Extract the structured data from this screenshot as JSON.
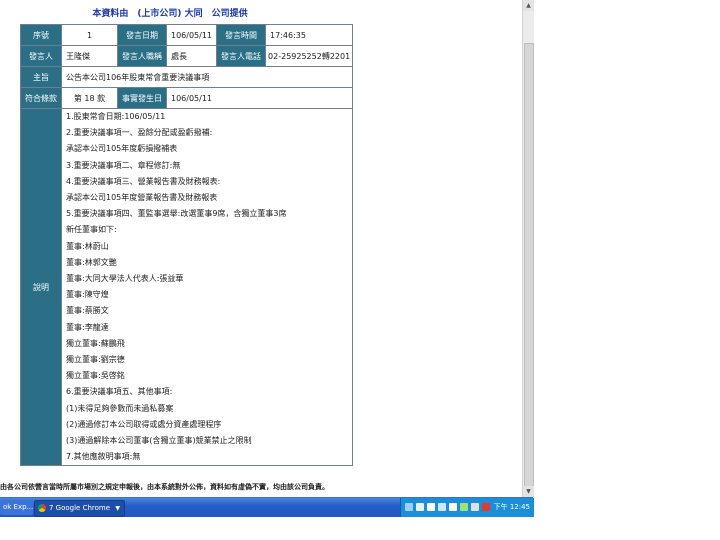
{
  "header": {
    "title": "本資料由　(上市公司) 大同　公司提供"
  },
  "row1": {
    "seq_label": "序號",
    "seq_value": "1",
    "date_label": "發言日期",
    "date_value": "106/05/11",
    "time_label": "發言時間",
    "time_value": "17:46:35"
  },
  "row2": {
    "speaker_label": "發言人",
    "speaker_value": "王隆傑",
    "title_label": "發言人職稱",
    "title_value": "處長",
    "phone_label": "發言人電話",
    "phone_value": "02-25925252轉2201"
  },
  "row3": {
    "subject_label": "主旨",
    "subject_value": "公告本公司106年股東常會重要決議事項"
  },
  "row4": {
    "clause_label": "符合條款",
    "clause_value": "第 18 款",
    "event_date_label": "事實發生日",
    "event_date_value": "106/05/11"
  },
  "description": {
    "label": "說明",
    "lines": [
      "1.股東常會日期:106/05/11",
      "2.重要決議事項一、盈餘分配或盈虧撥補:",
      "承認本公司105年度虧損撥補表",
      "3.重要決議事項二、章程修訂:無",
      "4.重要決議事項三、營業報告書及財務報表:",
      "承認本公司105年度營業報告書及財務報表",
      "5.重要決議事項四、董監事選舉:改選董事9席，含獨立董事3席",
      "新任董事如下:",
      "董事:林蔚山",
      "董事:林郭文艷",
      "董事:大同大學法人代表人:張益華",
      "董事:陳守煌",
      "董事:蔡勝文",
      "董事:李龍達",
      "獨立董事:蘇鵬飛",
      "獨立董事:劉宗德",
      "獨立董事:吳啓銘",
      "6.重要決議事項五、其他事項:",
      "(1)未得足夠參數而未過私募案",
      "(2)通過修訂本公司取得或處分資產處理程序",
      "(3)通過解除本公司董事(含獨立董事)競業禁止之限制",
      "7.其他應敘明事項:無"
    ]
  },
  "footer": {
    "note": "由各公司依營言當時所屬市場別之規定申報後，由本系統對外公佈，資料如有虛偽不實，均由該公司負責。"
  },
  "taskbar": {
    "left_item": "ok Exp...",
    "chrome_item": "7 Google Chrome",
    "clock": "下午 12:45"
  }
}
